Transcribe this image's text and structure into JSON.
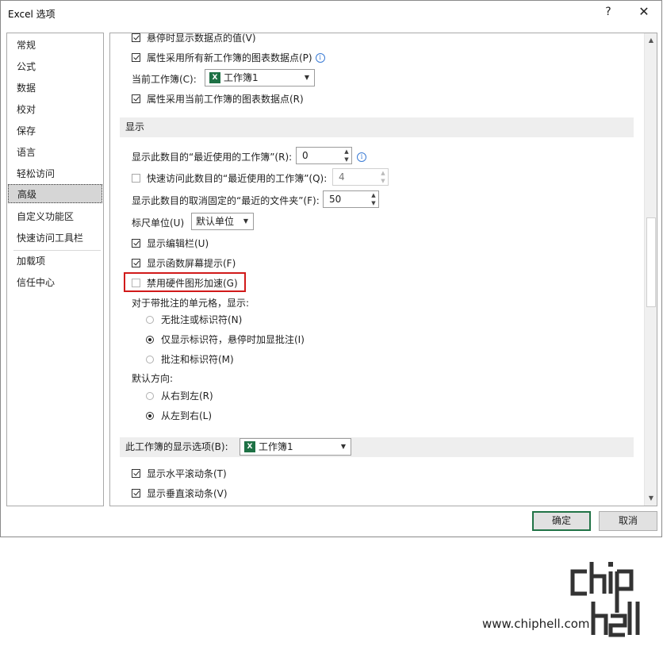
{
  "window": {
    "title": "Excel 选项",
    "help": "?",
    "close": "✕"
  },
  "nav": [
    {
      "label": "常规"
    },
    {
      "label": "公式"
    },
    {
      "label": "数据"
    },
    {
      "label": "校对"
    },
    {
      "label": "保存"
    },
    {
      "label": "语言"
    },
    {
      "label": "轻松访问"
    },
    {
      "label": "高级",
      "selected": true
    },
    {
      "label": "自定义功能区"
    },
    {
      "label": "快速访问工具栏"
    },
    {
      "label": "加载项"
    },
    {
      "label": "信任中心"
    }
  ],
  "content": {
    "top_partial": "悬停时显示数据点的值(V)",
    "chart_props_new": "属性采用所有新工作簿的图表数据点(P)",
    "current_workbook_label": "当前工作簿(C):",
    "current_workbook_value": "工作簿1",
    "chart_props_current": "属性采用当前工作簿的图表数据点(R)",
    "display_section": "显示",
    "recent_workbooks_label": "显示此数目的“最近使用的工作簿”(R):",
    "recent_workbooks_value": "0",
    "quick_access_label": "快速访问此数目的“最近使用的工作簿”(Q):",
    "quick_access_value": "4",
    "unpinned_folders_label": "显示此数目的取消固定的“最近的文件夹”(F):",
    "unpinned_folders_value": "50",
    "ruler_units_label": "标尺单位(U)",
    "ruler_units_value": "默认单位",
    "show_formula_bar": "显示编辑栏(U)",
    "show_function_tips": "显示函数屏幕提示(F)",
    "disable_hw_accel": "禁用硬件图形加速(G)",
    "comments_label": "对于带批注的单元格，显示:",
    "comments_none": "无批注或标识符(N)",
    "comments_indicator": "仅显示标识符，悬停时加显批注(I)",
    "comments_both": "批注和标识符(M)",
    "direction_label": "默认方向:",
    "direction_rtl": "从右到左(R)",
    "direction_ltr": "从左到右(L)",
    "workbook_display_section": "此工作簿的显示选项(B):",
    "workbook_display_value": "工作簿1",
    "show_hscroll": "显示水平滚动条(T)",
    "show_vscroll": "显示垂直滚动条(V)"
  },
  "icons": {
    "excel": "X",
    "info": "i",
    "spin_up": "▲",
    "spin_down": "▼",
    "dropdown": "▼",
    "scroll_up": "▲",
    "scroll_down": "▼"
  },
  "buttons": {
    "ok": "确定",
    "cancel": "取消"
  },
  "watermark": {
    "url": "www.chiphell.com"
  },
  "colors": {
    "highlight": "#d11a1a",
    "excel_green": "#1e7145",
    "info_blue": "#3a7bd5"
  }
}
